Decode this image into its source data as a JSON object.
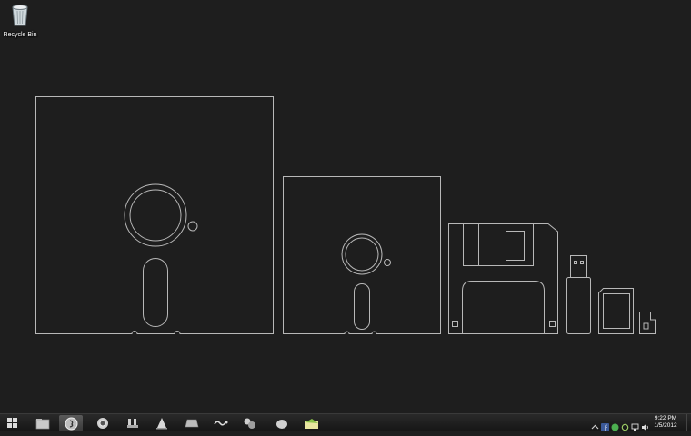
{
  "desktop": {
    "icons": [
      {
        "label": "Recycle Bin",
        "icon": "recycle-bin-icon"
      }
    ],
    "wallpaper": {
      "background": "#1e1e1e",
      "line_color": "#b8b8b8",
      "items": [
        "8-inch-floppy-disk",
        "5.25-inch-floppy-disk",
        "3.5-inch-floppy-disk",
        "usb-flash-drive",
        "sd-card",
        "microsd-card"
      ]
    }
  },
  "taskbar": {
    "start_icon": "windows-start-icon",
    "pinned": [
      {
        "name": "file-explorer",
        "icon": "folder-icon",
        "active": false
      },
      {
        "name": "media-app",
        "icon": "media-disc-icon",
        "active": true
      },
      {
        "name": "chrome",
        "icon": "chrome-icon",
        "active": false
      },
      {
        "name": "app-4",
        "icon": "tower-icon",
        "active": false
      },
      {
        "name": "vlc",
        "icon": "cone-icon",
        "active": false
      },
      {
        "name": "app-6",
        "icon": "box-icon",
        "active": false
      },
      {
        "name": "app-7",
        "icon": "link-icon",
        "active": false
      },
      {
        "name": "app-8",
        "icon": "orbs-icon",
        "active": false
      },
      {
        "name": "app-9",
        "icon": "stone-icon",
        "active": false
      },
      {
        "name": "app-10",
        "icon": "folder-alt-icon",
        "active": false
      }
    ],
    "tray": {
      "icons": [
        "expand-arrow-icon",
        "facebook-icon",
        "green-app-icon",
        "sync-icon",
        "network-icon",
        "volume-icon"
      ],
      "time": "9:22 PM",
      "date": "1/5/2012"
    }
  }
}
